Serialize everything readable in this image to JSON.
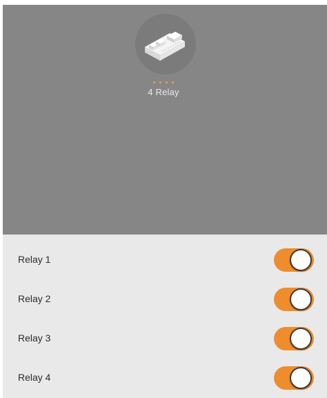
{
  "device": {
    "name": "4 Relay",
    "icon": "relay-module-icon",
    "indicator_dot_count": 4,
    "indicator_color": "#f0a04a"
  },
  "relays": [
    {
      "label": "Relay 1",
      "state": "on"
    },
    {
      "label": "Relay 2",
      "state": "on"
    },
    {
      "label": "Relay 3",
      "state": "on"
    },
    {
      "label": "Relay 4",
      "state": "on"
    }
  ],
  "colors": {
    "header_bg": "#868686",
    "list_bg": "#e9e9e9",
    "toggle_on": "#ef8d2e"
  }
}
